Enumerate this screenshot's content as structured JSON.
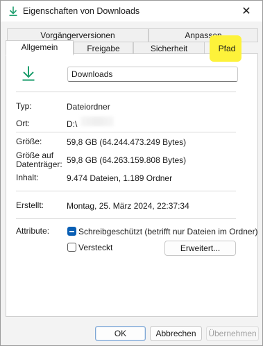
{
  "window": {
    "title": "Eigenschaften von Downloads",
    "close_glyph": "✕",
    "icon": "download-arrow-icon"
  },
  "tabs": {
    "row1": [
      {
        "label": "Vorgängerversionen"
      },
      {
        "label": "Anpassen"
      }
    ],
    "row2": [
      {
        "label": "Allgemein",
        "active": true
      },
      {
        "label": "Freigabe"
      },
      {
        "label": "Sicherheit"
      },
      {
        "label": "Pfad"
      }
    ]
  },
  "general": {
    "folder_icon": "download-arrow-icon",
    "name": "Downloads",
    "rows": {
      "type": {
        "label": "Typ:",
        "value": "Dateiordner"
      },
      "location": {
        "label": "Ort:",
        "value": "D:\\"
      },
      "size": {
        "label": "Größe:",
        "value": "59,8 GB (64.244.473.249 Bytes)"
      },
      "size_on_disk": {
        "label_line1": "Größe auf",
        "label_line2": "Datenträger:",
        "value": "59,8 GB (64.263.159.808 Bytes)"
      },
      "contents": {
        "label": "Inhalt:",
        "value": "9.474 Dateien, 1.189 Ordner"
      },
      "created": {
        "label": "Erstellt:",
        "value": "Montag, 25. März 2024, 22:37:34"
      }
    },
    "attributes": {
      "label": "Attribute:",
      "readonly": {
        "label": "Schreibgeschützt (betrifft nur Dateien im Ordner)",
        "state": "indeterminate"
      },
      "hidden": {
        "label": "Versteckt",
        "checked": false
      },
      "advanced_button": "Erweitert..."
    }
  },
  "footer": {
    "ok": "OK",
    "cancel": "Abbrechen",
    "apply": "Übernehmen"
  },
  "colors": {
    "accent": "#0a5fb4",
    "icon_green": "#1e9e6e",
    "highlight": "#fdf23a"
  }
}
